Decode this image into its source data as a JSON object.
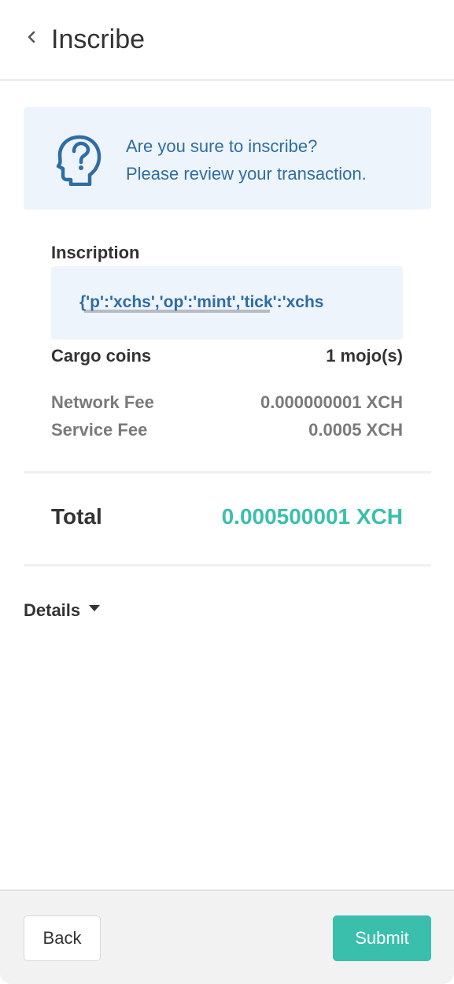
{
  "header": {
    "title": "Inscribe",
    "back_icon": "chevron-left-icon"
  },
  "banner": {
    "icon": "head-question-icon",
    "line1": "Are you sure to inscribe?",
    "line2": "Please review your transaction."
  },
  "inscription": {
    "label": "Inscription",
    "value": "{'p':'xchs','op':'mint','tick':'xchs"
  },
  "cargo": {
    "label": "Cargo coins",
    "value": "1 mojo(s)"
  },
  "fees": [
    {
      "label": "Network Fee",
      "value": "0.000000001 XCH"
    },
    {
      "label": "Service Fee",
      "value": "0.0005 XCH"
    }
  ],
  "total": {
    "label": "Total",
    "value": "0.000500001 XCH"
  },
  "details": {
    "label": "Details",
    "icon": "caret-down-icon"
  },
  "footer": {
    "back_label": "Back",
    "submit_label": "Submit"
  },
  "colors": {
    "accent": "#3bbfad",
    "info_blue": "#2e6da4",
    "banner_bg": "#eef4fb"
  }
}
